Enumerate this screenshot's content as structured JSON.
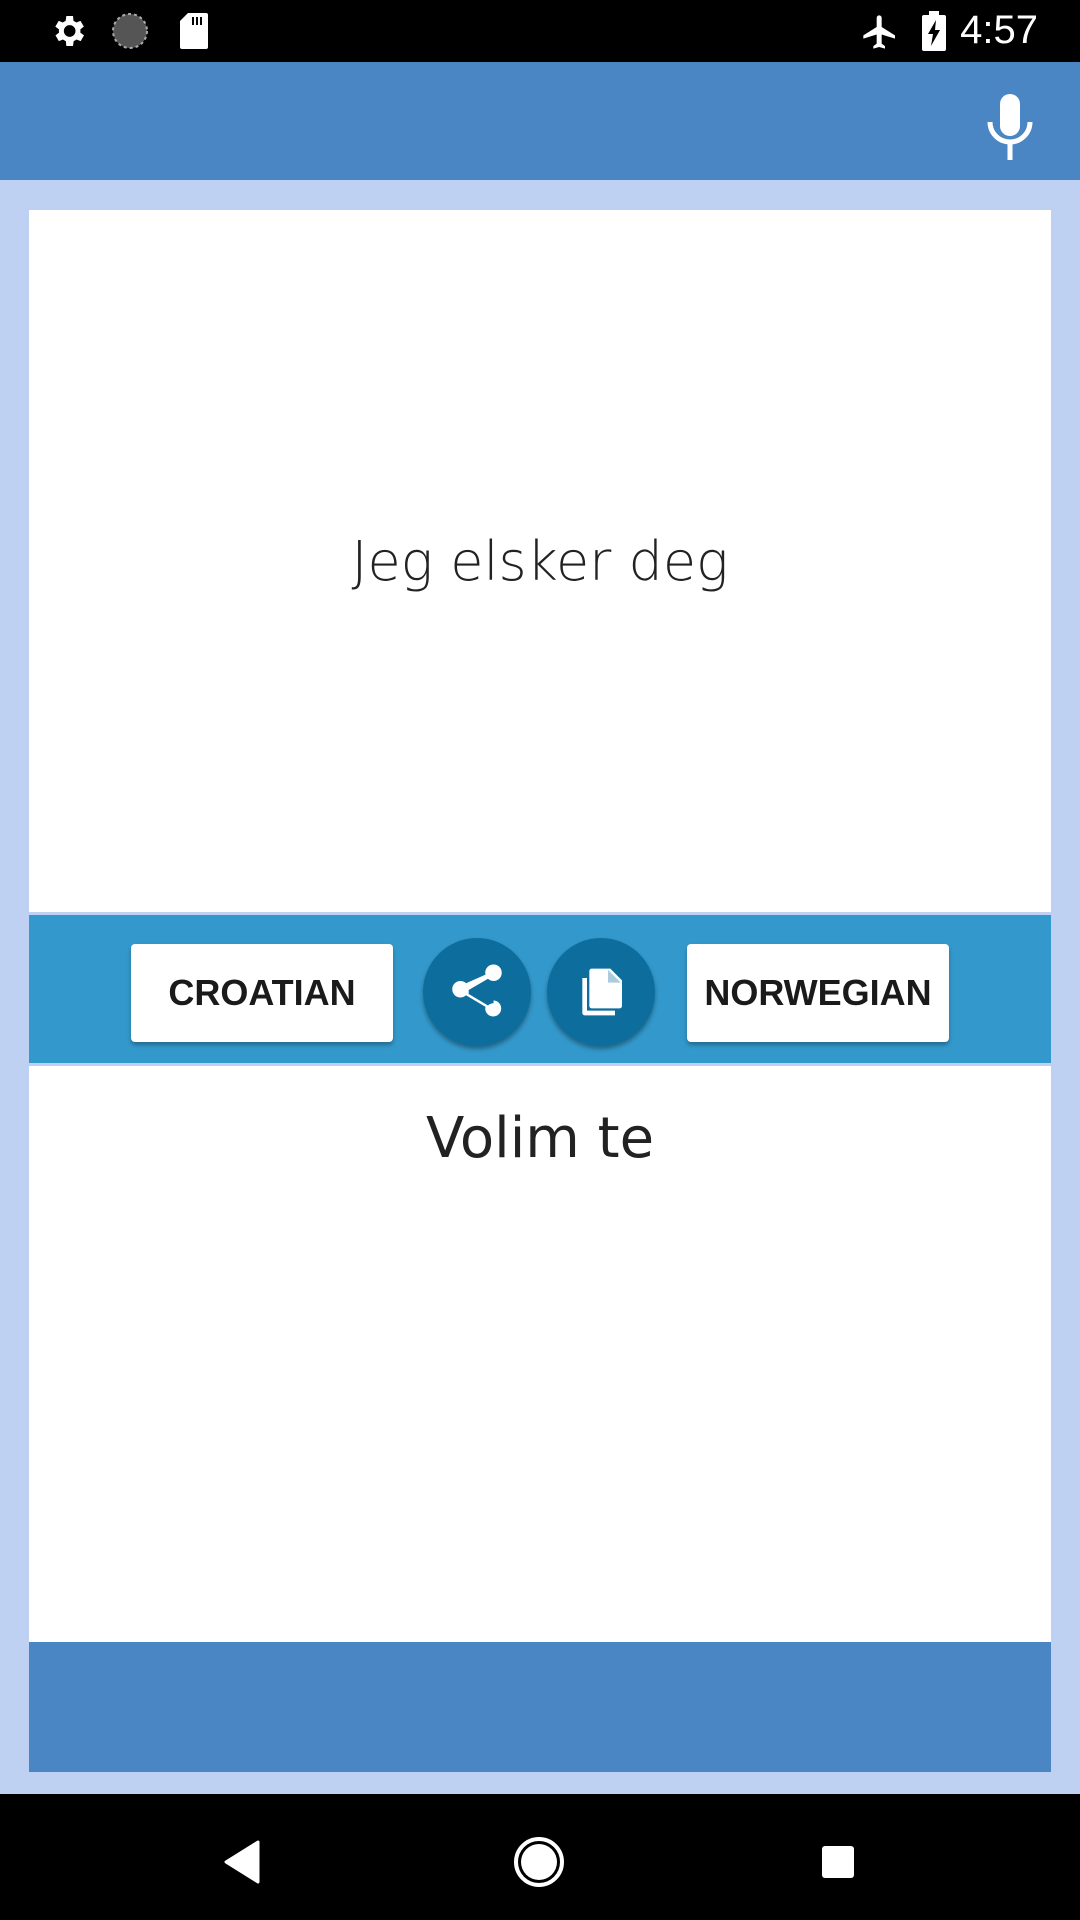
{
  "status_bar": {
    "left_icons": [
      "gear-icon",
      "sync-circle-icon",
      "sd-card-icon"
    ],
    "right_icons": [
      "airplane-mode-icon",
      "battery-charging-icon"
    ],
    "time": "4:57"
  },
  "toolbar": {
    "mic_icon": "microphone-icon"
  },
  "translation": {
    "source_text": "Jeg elsker deg",
    "target_text": "Volim te",
    "source_language_button": "CROATIAN",
    "target_language_button": "NORWEGIAN",
    "share_icon": "share-icon",
    "copy_icon": "copy-icon"
  },
  "colors": {
    "toolbar": "#4a86c3",
    "background": "#bfd1f2",
    "middle_bar": "#3399cc",
    "round_button": "#0d6e9e"
  },
  "navigation": {
    "buttons": [
      "back",
      "home",
      "recents"
    ]
  }
}
